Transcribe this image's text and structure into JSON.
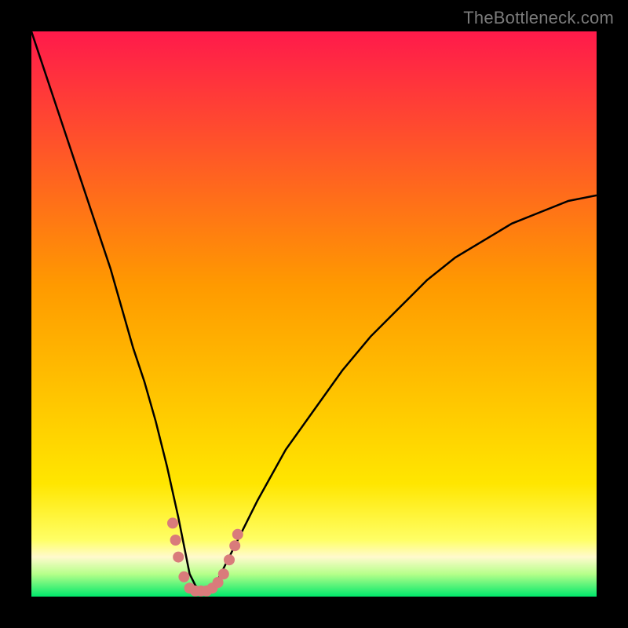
{
  "watermark": "TheBottleneck.com",
  "chart_data": {
    "type": "line",
    "title": "",
    "xlabel": "",
    "ylabel": "",
    "xlim": [
      0,
      100
    ],
    "ylim": [
      0,
      100
    ],
    "background_gradient": {
      "stops": [
        {
          "pct": 0.0,
          "color": "#ff1a4b"
        },
        {
          "pct": 0.45,
          "color": "#ff9a00"
        },
        {
          "pct": 0.8,
          "color": "#ffe600"
        },
        {
          "pct": 0.9,
          "color": "#ffff66"
        },
        {
          "pct": 0.93,
          "color": "#fffacd"
        },
        {
          "pct": 0.96,
          "color": "#b6ff8a"
        },
        {
          "pct": 1.0,
          "color": "#00e86b"
        }
      ]
    },
    "series": [
      {
        "name": "bottleneck-curve",
        "stroke": "#000000",
        "x": [
          0,
          2,
          4,
          6,
          8,
          10,
          12,
          14,
          16,
          18,
          20,
          22,
          24,
          26,
          27,
          28,
          29,
          30,
          31,
          32,
          33,
          34,
          36,
          38,
          40,
          45,
          50,
          55,
          60,
          65,
          70,
          75,
          80,
          85,
          90,
          95,
          100
        ],
        "y": [
          100,
          94,
          88,
          82,
          76,
          70,
          64,
          58,
          51,
          44,
          38,
          31,
          23,
          14,
          9,
          4,
          2,
          1,
          1,
          2,
          3,
          5,
          9,
          13,
          17,
          26,
          33,
          40,
          46,
          51,
          56,
          60,
          63,
          66,
          68,
          70,
          71
        ]
      }
    ],
    "markers": [
      {
        "name": "dot",
        "x": 25.0,
        "y": 13.0,
        "r": 7,
        "color": "#d97b7b"
      },
      {
        "name": "dot",
        "x": 25.5,
        "y": 10.0,
        "r": 7,
        "color": "#d97b7b"
      },
      {
        "name": "dot",
        "x": 26.0,
        "y": 7.0,
        "r": 7,
        "color": "#d97b7b"
      },
      {
        "name": "dot",
        "x": 27.0,
        "y": 3.5,
        "r": 7,
        "color": "#d97b7b"
      },
      {
        "name": "dot",
        "x": 28.0,
        "y": 1.5,
        "r": 7,
        "color": "#d97b7b"
      },
      {
        "name": "dot",
        "x": 29.0,
        "y": 1.0,
        "r": 7,
        "color": "#d97b7b"
      },
      {
        "name": "dot",
        "x": 30.0,
        "y": 1.0,
        "r": 7,
        "color": "#d97b7b"
      },
      {
        "name": "dot",
        "x": 31.0,
        "y": 1.0,
        "r": 7,
        "color": "#d97b7b"
      },
      {
        "name": "dot",
        "x": 32.0,
        "y": 1.5,
        "r": 7,
        "color": "#d97b7b"
      },
      {
        "name": "dot",
        "x": 33.0,
        "y": 2.5,
        "r": 7,
        "color": "#d97b7b"
      },
      {
        "name": "dot",
        "x": 34.0,
        "y": 4.0,
        "r": 7,
        "color": "#d97b7b"
      },
      {
        "name": "dot",
        "x": 35.0,
        "y": 6.5,
        "r": 7,
        "color": "#d97b7b"
      },
      {
        "name": "dot",
        "x": 36.0,
        "y": 9.0,
        "r": 7,
        "color": "#d97b7b"
      },
      {
        "name": "dot",
        "x": 36.5,
        "y": 11.0,
        "r": 7,
        "color": "#d97b7b"
      }
    ]
  }
}
